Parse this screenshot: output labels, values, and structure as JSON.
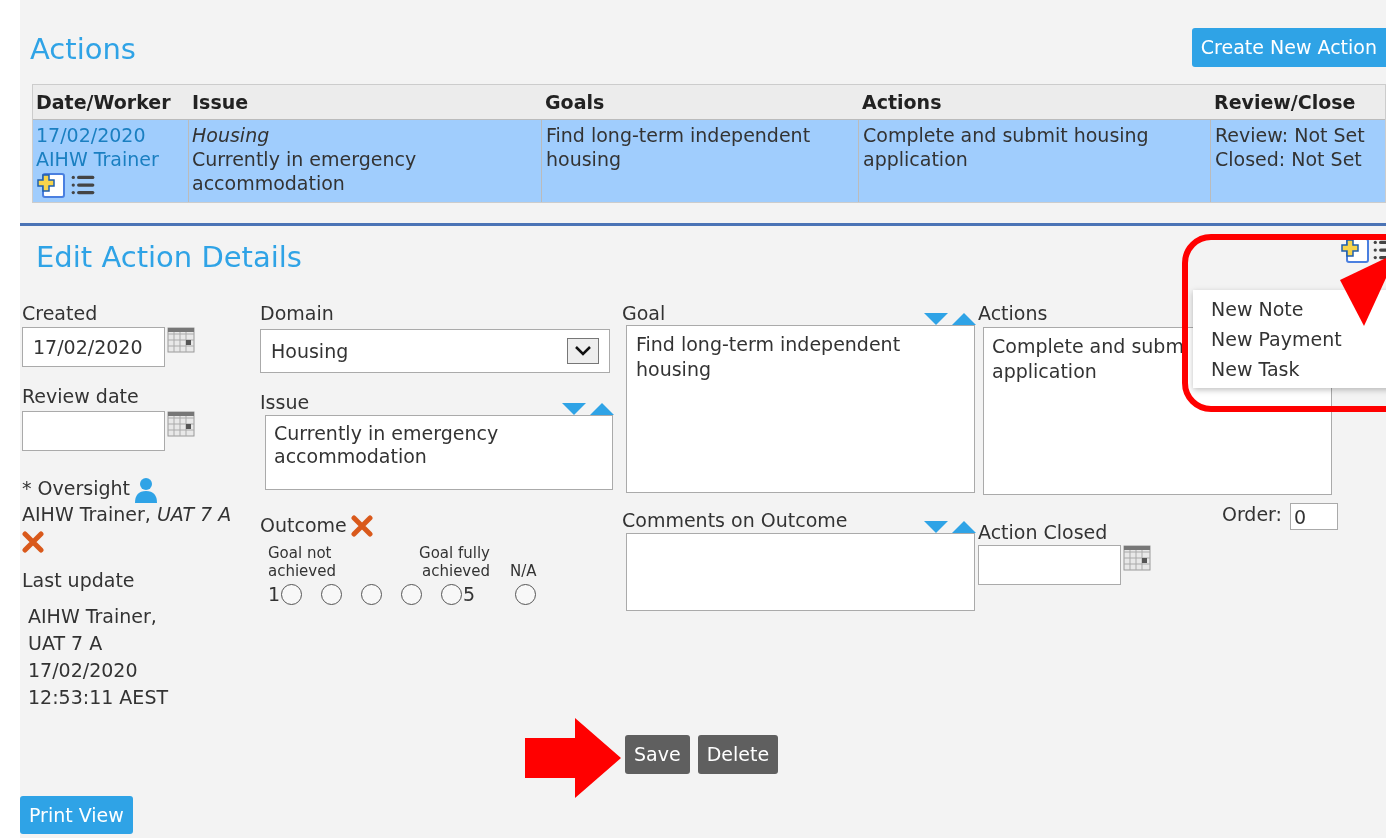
{
  "header": {
    "title": "Actions",
    "create_button": "Create New Action"
  },
  "table": {
    "columns": [
      "Date/Worker",
      "Issue",
      "Goals",
      "Actions",
      "Review/Close"
    ],
    "rows": [
      {
        "selected": true,
        "date": "17/02/2020",
        "worker": "AIHW Trainer",
        "issue_domain": "Housing",
        "issue": "Currently in emergency accommodation",
        "goals": "Find long-term independent housing",
        "actions": "Complete and submit housing application",
        "review": "Review: Not Set",
        "closed": "Closed: Not Set"
      }
    ]
  },
  "edit": {
    "title": "Edit Action Details",
    "menu": [
      {
        "label": "New Note"
      },
      {
        "label": "New Payment"
      },
      {
        "label": "New Task"
      }
    ],
    "created": {
      "label": "Created",
      "value": "17/02/2020"
    },
    "review_date": {
      "label": "Review date"
    },
    "oversight": {
      "label": "* Oversight",
      "value": "AIHW Trainer, *UAT 7 A*"
    },
    "last_update": {
      "label": "Last update",
      "lines": [
        "AIHW Trainer,",
        "UAT 7 A",
        "17/02/2020",
        "12:53:11 AEST"
      ]
    },
    "domain": {
      "label": "Domain",
      "value": "Housing"
    },
    "issue": {
      "label": "Issue",
      "value": "Currently in emergency accommodation"
    },
    "outcome": {
      "label": "Outcome",
      "low_label": "Goal not achieved",
      "high_label": "Goal fully achieved",
      "na_label": "N/A",
      "low_value": "1",
      "high_value": "5",
      "options": [
        {
          "selected": false
        },
        {
          "selected": false
        },
        {
          "selected": false
        },
        {
          "selected": false
        },
        {
          "selected": false
        },
        {
          "selected": false
        }
      ]
    },
    "goal": {
      "label": "Goal",
      "value": "Find long-term independent housing"
    },
    "comments": {
      "label": "Comments on Outcome"
    },
    "actions": {
      "label": "Actions",
      "value": "Complete and subm\napplication"
    },
    "action_closed": {
      "label": "Action Closed"
    },
    "order": {
      "label": "Order:",
      "value": "0"
    }
  },
  "buttons": [
    "Save",
    "Delete"
  ],
  "print_button": "Print View"
}
